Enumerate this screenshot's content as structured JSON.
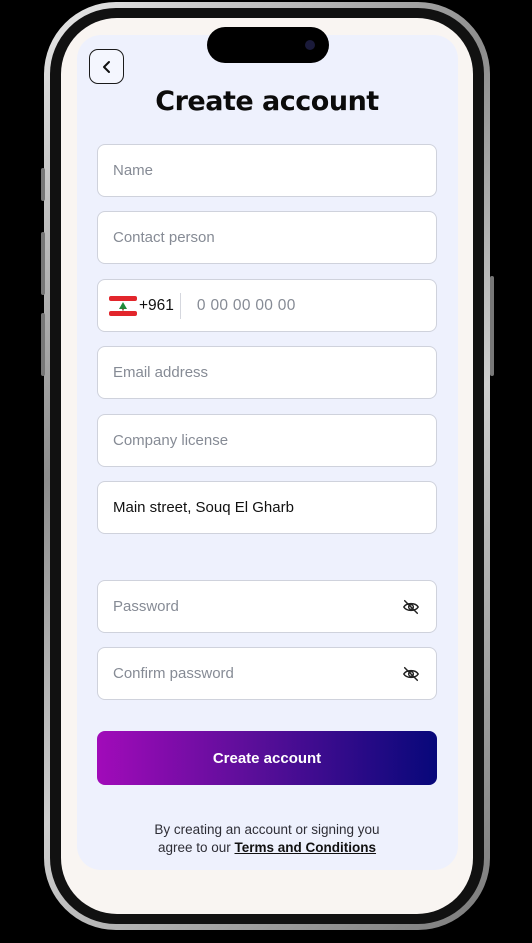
{
  "header": {
    "title": "Create account",
    "back_icon": "chevron-left-icon"
  },
  "form": {
    "name_placeholder": "Name",
    "contact_placeholder": "Contact person",
    "phone": {
      "flag": "lebanon-flag",
      "dial_code": "+961",
      "placeholder": "0 00 00 00 00"
    },
    "email_placeholder": "Email address",
    "license_placeholder": "Company license",
    "address_value": "Main street, Souq El Gharb",
    "password_placeholder": "Password",
    "confirm_placeholder": "Confirm password",
    "eye_icon": "eye-off-icon"
  },
  "cta": {
    "label": "Create account",
    "gradient": [
      "#a10bb9",
      "#07087a"
    ]
  },
  "terms": {
    "line1": "By creating an account or signing you",
    "line2_prefix": "agree to our ",
    "link": "Terms and Conditions"
  },
  "colors": {
    "card_bg": "#eef1fd",
    "screen_bg": "#f9f5f2"
  }
}
